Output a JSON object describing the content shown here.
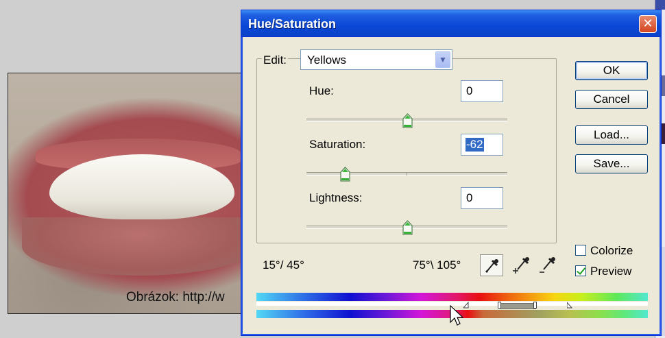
{
  "background_image": {
    "caption": "Obrázok: http://w"
  },
  "dialog": {
    "title": "Hue/Saturation",
    "edit": {
      "label": "Edit:",
      "selected": "Yellows"
    },
    "sliders": [
      {
        "label": "Hue:",
        "value": "0",
        "level": 0.5
      },
      {
        "label": "Saturation:",
        "value": "-62",
        "level": 0.19
      },
      {
        "label": "Lightness:",
        "value": "0",
        "level": 0.5
      }
    ],
    "buttons": {
      "ok": "OK",
      "cancel": "Cancel",
      "load": "Load...",
      "save": "Save..."
    },
    "checkboxes": {
      "colorize": {
        "label": "Colorize",
        "checked": false
      },
      "preview": {
        "label": "Preview",
        "checked": true
      }
    },
    "range": {
      "left": "15°/ 45°",
      "right": "75°\\ 105°"
    },
    "icons": [
      "eyedropper-icon",
      "eyedropper-plus-icon",
      "eyedropper-minus-icon"
    ]
  }
}
